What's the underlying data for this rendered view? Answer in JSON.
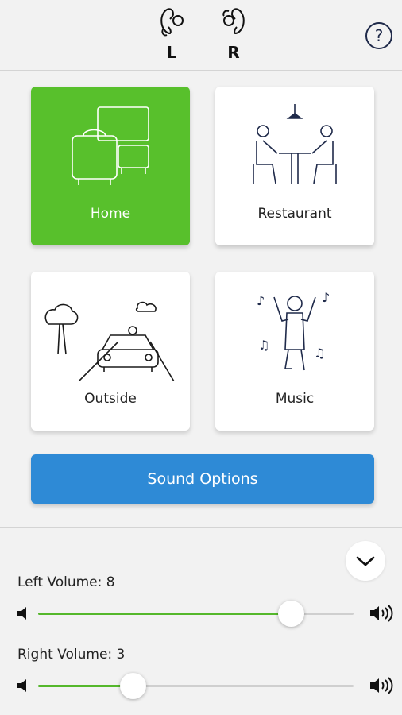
{
  "header": {
    "left_ear": {
      "label": "L",
      "icon": "left-ear-hearing-aid-icon"
    },
    "right_ear": {
      "label": "R",
      "icon": "right-ear-hearing-aid-icon"
    },
    "help": {
      "icon": "help-icon",
      "glyph": "?"
    }
  },
  "programs": [
    {
      "label": "Home",
      "icon": "home-living-room-icon",
      "active": true
    },
    {
      "label": "Restaurant",
      "icon": "restaurant-table-icon",
      "active": false
    },
    {
      "label": "Outside",
      "icon": "outside-road-car-icon",
      "active": false
    },
    {
      "label": "Music",
      "icon": "music-dancer-icon",
      "active": false
    }
  ],
  "sound_options": {
    "label": "Sound Options"
  },
  "collapse": {
    "icon": "chevron-down-icon"
  },
  "volume": {
    "left": {
      "label": "Left Volume: 8",
      "value": 8,
      "max": 10
    },
    "right": {
      "label": "Right Volume: 3",
      "value": 3,
      "max": 10
    }
  },
  "colors": {
    "active_tile": "#58c02c",
    "button": "#2e8ad6",
    "slider_fill": "#55b82c",
    "icon_stroke": "#1f2a4a"
  }
}
